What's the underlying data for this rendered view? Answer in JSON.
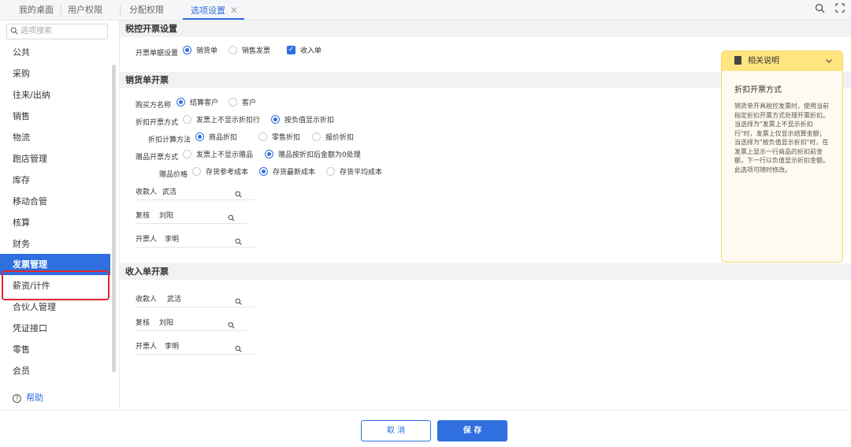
{
  "tabs": [
    {
      "label": "我的桌面"
    },
    {
      "label": "用户权限"
    },
    {
      "label": "分配权限"
    },
    {
      "label": "选项设置"
    }
  ],
  "top_icons": [
    "search-icon",
    "fullscreen-icon"
  ],
  "sidebar": {
    "search_placeholder": "选项搜索",
    "items": [
      {
        "label": "公共"
      },
      {
        "label": "采购"
      },
      {
        "label": "往来/出纳"
      },
      {
        "label": "销售"
      },
      {
        "label": "物流"
      },
      {
        "label": "跑店管理"
      },
      {
        "label": "库存"
      },
      {
        "label": "移动合管"
      },
      {
        "label": "核算"
      },
      {
        "label": "财务"
      },
      {
        "label": "发票管理"
      },
      {
        "label": "薪资/计件"
      },
      {
        "label": "合伙人管理"
      },
      {
        "label": "凭证接口"
      },
      {
        "label": "零售"
      },
      {
        "label": "会员"
      }
    ],
    "active_index": 10,
    "help_label": "帮助"
  },
  "sections": {
    "tax": {
      "title": "税控开票设置",
      "doc_label": "开票单据设置",
      "options": [
        {
          "label": "销货单",
          "type": "radio",
          "checked": true
        },
        {
          "label": "销售发票",
          "type": "radio",
          "checked": false
        },
        {
          "label": "收入单",
          "type": "checkbox",
          "checked": true
        }
      ]
    },
    "sales": {
      "title": "销货单开票",
      "buyer_label": "购买方名称",
      "buyer_options": [
        {
          "label": "结算客户",
          "checked": true
        },
        {
          "label": "客户",
          "checked": false
        }
      ],
      "discount_label": "折扣开票方式",
      "discount_options": [
        {
          "label": "发票上不显示折扣行",
          "checked": false
        },
        {
          "label": "按负值显示折扣",
          "checked": true
        }
      ],
      "calc_label": "折扣计算方法",
      "calc_options": [
        {
          "label": "商品折扣",
          "checked": true
        },
        {
          "label": "零售折扣",
          "checked": false
        },
        {
          "label": "报价折扣",
          "checked": false
        }
      ],
      "gift_label": "赠品开票方式",
      "gift_options": [
        {
          "label": "发票上不显示赠品",
          "checked": false
        },
        {
          "label": "赠品按折扣后金额为0处理",
          "checked": true
        }
      ],
      "gift_price_label": "赠品价格",
      "gift_price_options": [
        {
          "label": "存货参考成本",
          "checked": false
        },
        {
          "label": "存货最新成本",
          "checked": true
        },
        {
          "label": "存货平均成本",
          "checked": false
        }
      ],
      "fields": [
        {
          "label": "收款人",
          "value": "武洁"
        },
        {
          "label": "复核",
          "value": "刘阳"
        },
        {
          "label": "开票人",
          "value": "李明"
        }
      ]
    },
    "income": {
      "title": "收入单开票",
      "fields": [
        {
          "label": "收款人",
          "value": "武洁"
        },
        {
          "label": "复核",
          "value": "刘阳"
        },
        {
          "label": "开票人",
          "value": "李明"
        }
      ]
    }
  },
  "help_panel": {
    "header": "相关说明",
    "title": "折扣开票方式",
    "body": "销货单开具税控发票时，使用当前指定折扣开票方式处理开票折扣。\n当选择为\"发票上不显示折扣行\"时，发票上仅显示结算金额；\n当选择为\"按负值显示折扣\"时，在发票上显示一行商品的折扣前金额，下一行以负值显示折扣金额。\n此选项可随时修改。"
  },
  "footer": {
    "cancel_label": "取 消",
    "save_label": "保 存"
  },
  "colors": {
    "accent": "#2f6fe0",
    "highlight_border": "#e3262c",
    "help_header": "#ffe57f"
  }
}
